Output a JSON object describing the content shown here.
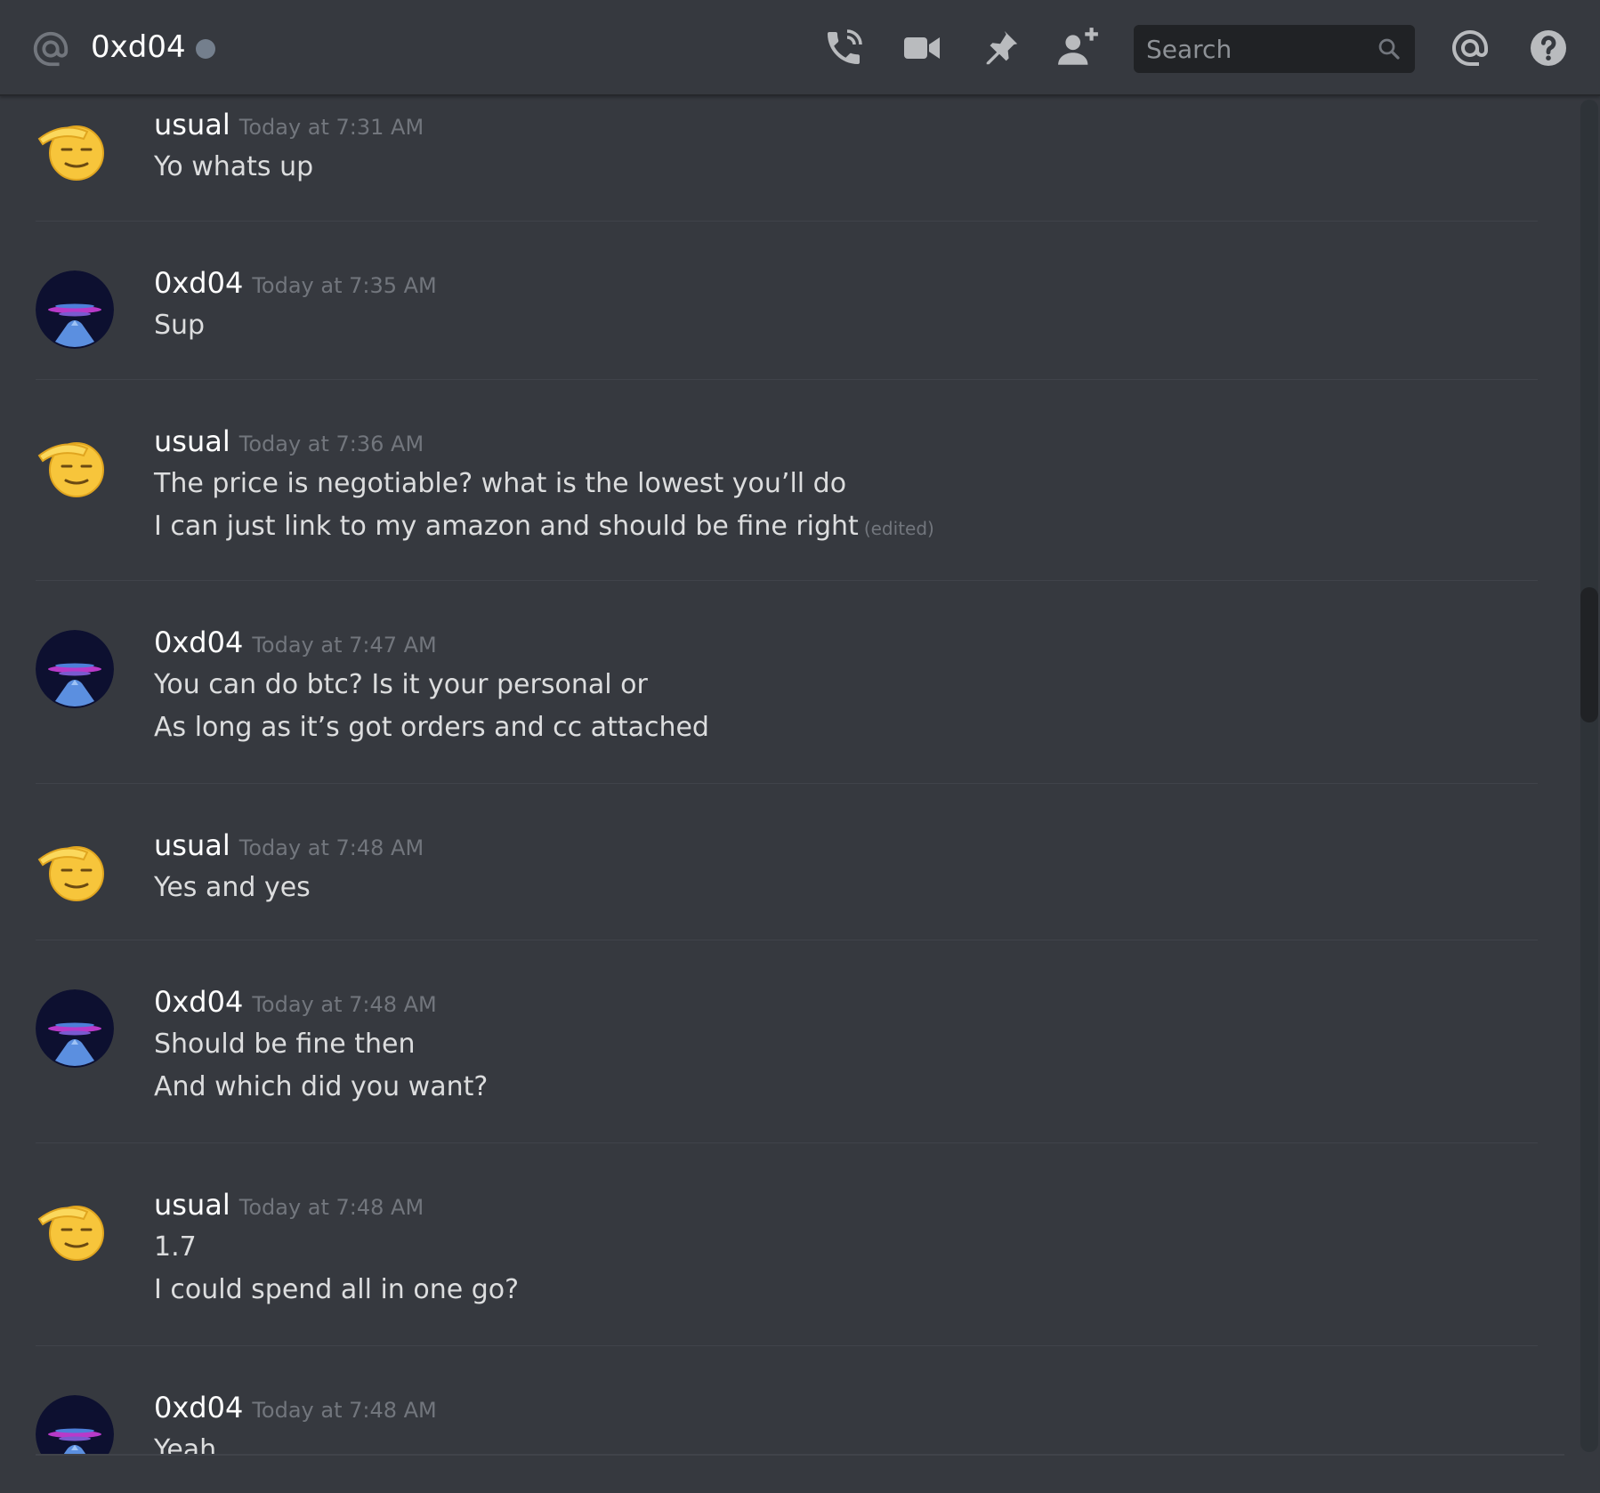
{
  "header": {
    "channel_name": "0xd04",
    "status": "offline",
    "icons": [
      "at-icon",
      "phone-call-icon",
      "video-camera-icon",
      "pin-icon",
      "add-friend-icon",
      "mention-at-icon",
      "help-icon"
    ],
    "search_placeholder": "Search"
  },
  "colors": {
    "background": "#36393f",
    "header_border": "#26282c",
    "search_bg": "#202225",
    "username": "#ffffff",
    "timestamp": "#72767d",
    "message_text": "#dcddde",
    "status_offline": "#747f8d"
  },
  "messages": [
    {
      "author": "usual",
      "avatar_icon": "saluting-face-emoji-icon",
      "timestamp": "Today at 7:31 AM",
      "lines": [
        "Yo whats up"
      ]
    },
    {
      "author": "0xd04",
      "avatar_icon": "dark-planet-avatar-icon",
      "timestamp": "Today at 7:35 AM",
      "lines": [
        "Sup"
      ]
    },
    {
      "author": "usual",
      "avatar_icon": "saluting-face-emoji-icon",
      "timestamp": "Today at 7:36 AM",
      "lines": [
        "The price is negotiable? what is the lowest you’ll do",
        "I can just link to my amazon and should be fine right"
      ],
      "edited_label": "(edited)"
    },
    {
      "author": "0xd04",
      "avatar_icon": "dark-planet-avatar-icon",
      "timestamp": "Today at 7:47 AM",
      "lines": [
        "You can do btc? Is it your personal or",
        "As long as it’s got orders and cc attached"
      ]
    },
    {
      "author": "usual",
      "avatar_icon": "saluting-face-emoji-icon",
      "timestamp": "Today at 7:48 AM",
      "lines": [
        "Yes and yes"
      ]
    },
    {
      "author": "0xd04",
      "avatar_icon": "dark-planet-avatar-icon",
      "timestamp": "Today at 7:48 AM",
      "lines": [
        "Should be fine then",
        "And which did you want?"
      ]
    },
    {
      "author": "usual",
      "avatar_icon": "saluting-face-emoji-icon",
      "timestamp": "Today at 7:48 AM",
      "lines": [
        "1.7",
        "I could spend all in one go?"
      ]
    },
    {
      "author": "0xd04",
      "avatar_icon": "dark-planet-avatar-icon",
      "timestamp": "Today at 7:48 AM",
      "lines": [
        "Yeah"
      ]
    }
  ]
}
